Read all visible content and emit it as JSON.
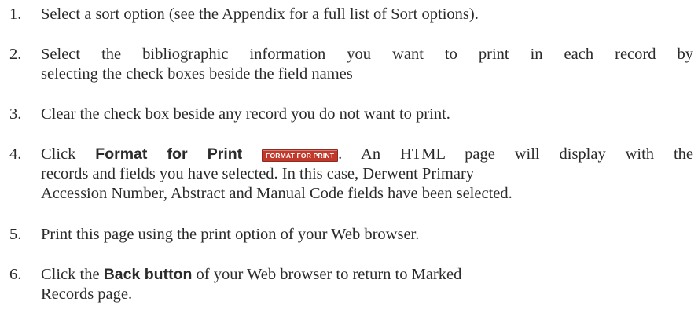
{
  "steps": [
    {
      "number": "1.",
      "lines": [
        "Select a sort option (see the Appendix for a full list of Sort options)."
      ]
    },
    {
      "number": "2.",
      "lines": [
        "Select the bibliographic information you want to print in each record by",
        "selecting the check boxes beside the field names"
      ]
    },
    {
      "number": "3.",
      "lines": [
        "Clear the check box beside any record you do not want to print."
      ]
    },
    {
      "number": "4.",
      "prefix": "Click ",
      "bold": "Format for Print",
      "button_label": "FORMAT FOR PRINT",
      "line1_rest": ". An HTML page will display with the",
      "lines": [
        "records and fields you have selected. In this case, Derwent Primary",
        "Accession Number, Abstract and Manual Code fields have been selected."
      ]
    },
    {
      "number": "5.",
      "lines": [
        "Print this page using the print option of your Web browser."
      ]
    },
    {
      "number": "6.",
      "prefix": "Click the ",
      "bold": "Back button",
      "line1_rest": " of your Web browser to return to Marked",
      "lines": [
        "Records page."
      ]
    }
  ],
  "colors": {
    "text": "#2b2b2b",
    "button_bg": "#c0392b",
    "button_text": "#ffffff"
  }
}
